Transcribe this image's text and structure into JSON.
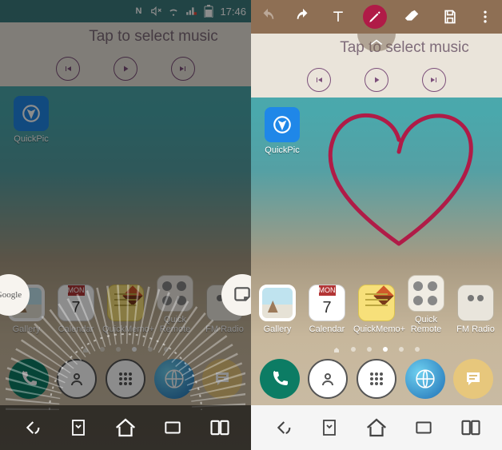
{
  "status": {
    "time": "17:46"
  },
  "music": {
    "title": "Tap to select music"
  },
  "quickpic": {
    "label": "QuickPic"
  },
  "apps": {
    "gallery": "Gallery",
    "calendar": "Calendar",
    "calendar_mon": "MON",
    "calendar_day": "7",
    "memo": "QuickMemo+",
    "remote": "Quick Remote",
    "radio": "FM Radio"
  },
  "radial": {
    "google": "Google"
  },
  "colors": {
    "pen": "#b01b47",
    "heart": "#b01b47",
    "toolbar": "#8e6f54"
  }
}
